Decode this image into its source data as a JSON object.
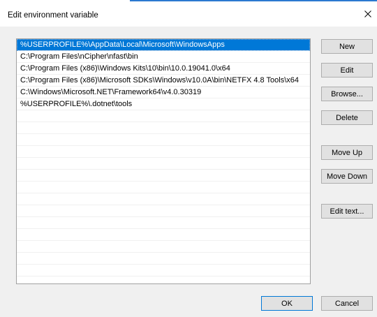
{
  "window": {
    "title": "Edit environment variable",
    "accent_color": "#2b79d0"
  },
  "paths": [
    "%USERPROFILE%\\AppData\\Local\\Microsoft\\WindowsApps",
    "C:\\Program Files\\nCipher\\nfast\\bin",
    "C:\\Program Files (x86)\\Windows Kits\\10\\bin\\10.0.19041.0\\x64",
    "C:\\Program Files (x86)\\Microsoft SDKs\\Windows\\v10.0A\\bin\\NETFX 4.8 Tools\\x64",
    "C:\\Windows\\Microsoft.NET\\Framework64\\v4.0.30319",
    "%USERPROFILE%\\.dotnet\\tools"
  ],
  "selected_index": 0,
  "selection_color": "#0078d7",
  "buttons": {
    "new": "New",
    "edit": "Edit",
    "browse": "Browse...",
    "delete": "Delete",
    "move_up": "Move Up",
    "move_down": "Move Down",
    "edit_text": "Edit text...",
    "ok": "OK",
    "cancel": "Cancel"
  }
}
